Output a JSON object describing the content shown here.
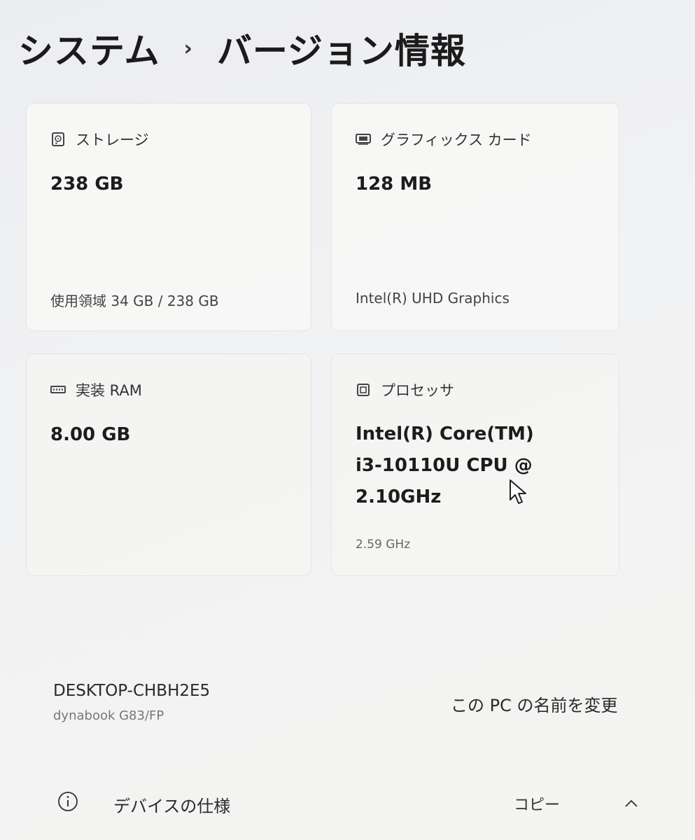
{
  "breadcrumb": {
    "parent": "システム",
    "separator": "›",
    "current": "バージョン情報"
  },
  "cards": {
    "storage": {
      "label": "ストレージ",
      "icon": "storage-drive-icon",
      "value": "238 GB",
      "detail": "使用領域 34 GB / 238 GB"
    },
    "graphics": {
      "label": "グラフィックス カード",
      "icon": "display-adapter-icon",
      "value": "128 MB",
      "detail": "Intel(R) UHD Graphics"
    },
    "ram": {
      "label": "実装 RAM",
      "icon": "memory-module-icon",
      "value": "8.00 GB",
      "detail": ""
    },
    "processor": {
      "label": "プロセッサ",
      "icon": "processor-chip-icon",
      "value_line1": "Intel(R) Core(TM)",
      "value_line2": "i3-10110U CPU @",
      "value_line3": "2.10GHz",
      "detail": "2.59 GHz"
    }
  },
  "device": {
    "name": "DESKTOP-CHBH2E5",
    "model": "dynabook G83/FP",
    "rename_label": "この PC の名前を変更"
  },
  "specs": {
    "label": "デバイスの仕様",
    "copy_label": "コピー",
    "icon": "info-icon",
    "expand_icon": "chevron-up-icon"
  }
}
